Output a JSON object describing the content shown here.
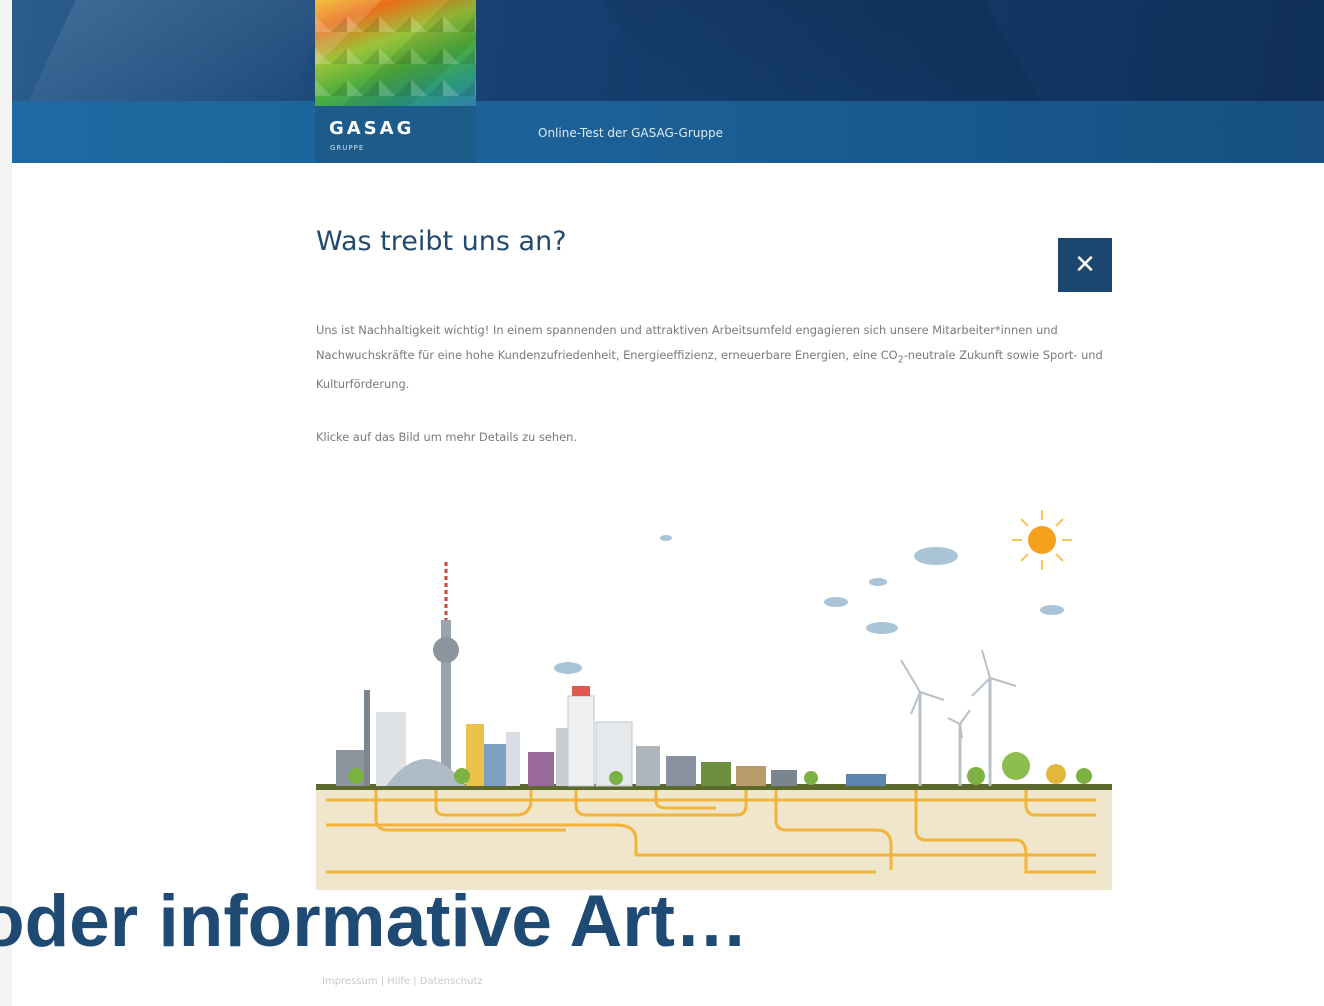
{
  "header": {
    "logo_text": "GASAG",
    "logo_subtext": "GRUPPE",
    "title": "Online-Test der GASAG-Gruppe"
  },
  "content": {
    "heading": "Was treibt uns an?",
    "paragraph_1_a": "Uns ist Nachhaltigkeit wichtig! In einem spannenden und attraktiven Arbeitsumfeld engagieren sich unsere Mitarbeiter*innen und Nachwuchskräfte für eine hohe Kundenzufriedenheit, Energieeffizienz, erneuerbare Energien, eine CO",
    "paragraph_1_sub": "2",
    "paragraph_1_b": "-neutrale Zukunft sowie Sport- und Kulturförderung.",
    "paragraph_2": "Klicke auf das Bild um mehr Details zu sehen.",
    "close_icon": "close-x-icon"
  },
  "overlay": {
    "caption": "oder informative Art…"
  },
  "footer": {
    "links": "Impressum | Hilfe | Datenschutz"
  },
  "colors": {
    "header_dark": "#173f6f",
    "header_band": "#1f6aa3",
    "accent": "#1b4670",
    "sun": "#f4a21b",
    "pipes": "#f2b43a",
    "ground": "#efe6cc"
  }
}
